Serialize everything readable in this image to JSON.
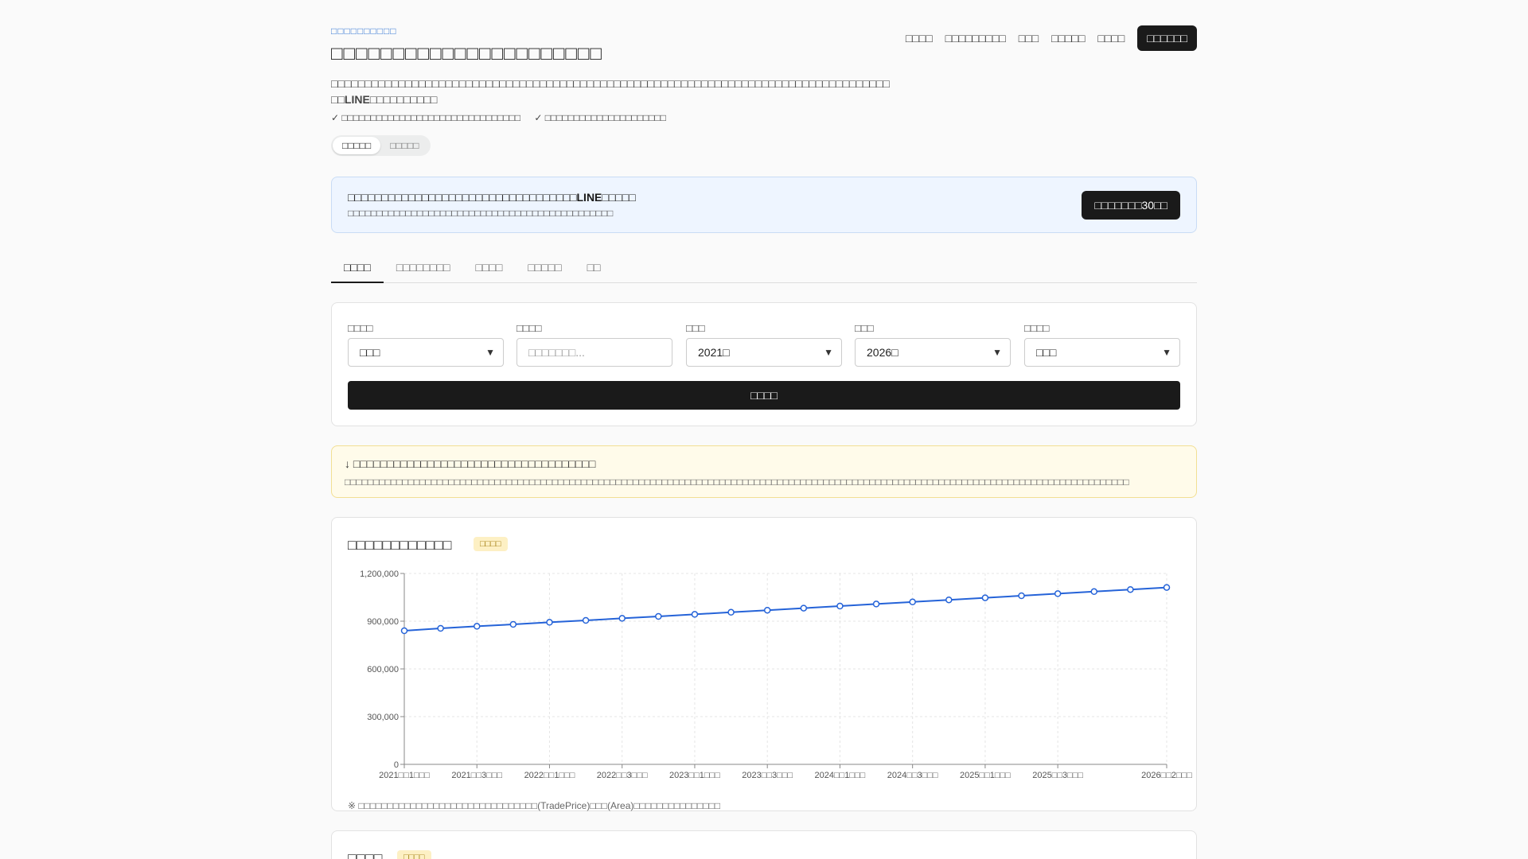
{
  "header": {
    "eyebrow": "□□□□□□□□□□",
    "title": "□□□□□□□□□□□□□□□□□□□□□□",
    "description_a": "□□□□□□",
    "description_b": "□□□□□□□□□□□",
    "description_c": "□□□□□□□□□□□□□□□□□□□□□□□□□□□□□□□□□□□□□□□□□□□□□□□□□□□□□□□□□□□□□□□□□□",
    "description_d": "□□",
    "description_e": "LINE",
    "description_f": "□□□□□□□□□□",
    "checks": [
      "✓ □□□□□□□□□□□□□□□□□□□□□□□□□□□□□□□",
      "✓ □□□□□□□□□□□□□□□□□□□□□"
    ],
    "toggle": [
      "□□□□□",
      "□□□□□"
    ]
  },
  "nav": {
    "items": [
      "□□□□",
      "□□□□□□□□□",
      "□□□",
      "□□□□□",
      "□□□□"
    ],
    "cta": "□□□□□□"
  },
  "banner": {
    "line1": "□□□□□□□□□□□□□□□□□□□□□□□□□□□□□□□□□□LINE□□□□□",
    "line2": "□□□□□□□□□□□□□□□□□□□□□□□□□□□□□□□□□□□□□□□□□□□□□□",
    "button": "□□□□□□□30□□"
  },
  "tabs": [
    "□□□□",
    "□□□□□□□□",
    "□□□□",
    "□□□□□",
    "□□"
  ],
  "filters": {
    "fields": [
      {
        "label": "□□□□",
        "value": "□□□"
      },
      {
        "label": "□□□□",
        "placeholder": "□□□□□□□..."
      },
      {
        "label": "□□□",
        "value": "2021□"
      },
      {
        "label": "□□□",
        "value": "2026□"
      },
      {
        "label": "□□□□",
        "value": "□□□"
      }
    ],
    "search_button": "□□□□"
  },
  "notice": {
    "line1": "↓ □□□□□□□□□□□□□□□□□□□□□□□□□□□□□□□□□□□□",
    "line2": "□□□□□□□□□□□□□□□□□□□□□□□□□□□□□□□□□□□□□□□□□□□□□□□□□□□□□□□□□□□□□□□□□□□□□□□□□□□□□□□□□□□□□□□□□□□□□□□□□□□□□□□□□□□□□□□□□□□□□□□□□□□□□□□□□□□□□□□□"
  },
  "chart_card": {
    "title": "□□□□□□□□□□□□",
    "badge": "□□□□",
    "footnote": "※ □□□□□□□□□□□□□□□□□□□□□□□□□□□□□□□(TradePrice)□□□(Area)□□□□□□□□□□□□□□□"
  },
  "next_card": {
    "title": "□□□□",
    "badge": "□□□□"
  },
  "colors": {
    "accent": "#2563d8",
    "dark": "#1a1a1a"
  },
  "chart_data": {
    "type": "line",
    "ylim": [
      0,
      1200000
    ],
    "yticks": [
      "0",
      "300,000",
      "600,000",
      "900,000",
      "1,200,000"
    ],
    "ytick_values": [
      0,
      300000,
      600000,
      900000,
      1200000
    ],
    "xtick_labels": [
      "2021□□1□□□",
      "2021□□3□□□",
      "2022□□1□□□",
      "2022□□3□□□",
      "2023□□1□□□",
      "2023□□3□□□",
      "2024□□1□□□",
      "2024□□3□□□",
      "2025□□1□□□",
      "2025□□3□□□",
      "2026□□2□□□"
    ],
    "xtick_index": [
      0,
      2,
      4,
      6,
      8,
      10,
      12,
      14,
      16,
      18,
      21
    ],
    "series": [
      {
        "values": [
          840000,
          855000,
          868000,
          880000,
          893000,
          905000,
          918000,
          930000,
          943000,
          956000,
          969000,
          982000,
          995000,
          1008000,
          1021000,
          1034000,
          1047000,
          1060000,
          1073000,
          1086000,
          1099000,
          1112000
        ]
      }
    ],
    "grid": true
  }
}
